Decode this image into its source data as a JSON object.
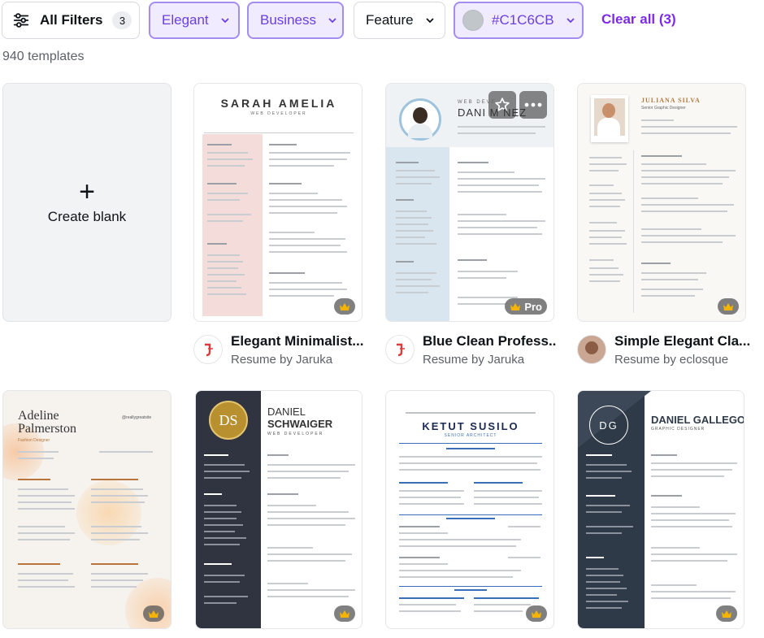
{
  "filters": {
    "all_filters_label": "All Filters",
    "all_filters_count": "3",
    "chips": [
      {
        "label": "Elegant",
        "selected": true
      },
      {
        "label": "Business",
        "selected": true
      },
      {
        "label": "Feature",
        "selected": false
      },
      {
        "label": "#C1C6CB",
        "selected": true,
        "swatch": "#C1C6CB"
      }
    ],
    "clear_all_label": "Clear all (3)"
  },
  "results": {
    "count_text": "940 templates"
  },
  "create_blank": {
    "label": "Create blank",
    "icon": "plus-icon"
  },
  "row1": [
    {
      "title": "Elegant Minimalist...",
      "subtitle": "Resume by Jaruka",
      "badge": "crown",
      "preview": {
        "name": "SARAH AMELIA",
        "role": "WEB DEVELOPER"
      }
    },
    {
      "title": "Blue Clean Profess...",
      "subtitle": "Resume by Jaruka",
      "badge": "Pro",
      "preview": {
        "role": "WEB DEVE",
        "name": "DANI M    NEZ"
      }
    },
    {
      "title": "Simple Elegant Cla...",
      "subtitle": "Resume by eclosque",
      "badge": "crown",
      "preview": {
        "name": "JULIANA SILVA",
        "role": "Senior Graphic Designer"
      }
    }
  ],
  "row2": [
    {
      "preview": {
        "name_line1": "Adeline",
        "name_line2": "Palmerston",
        "role": "Fashion Designer",
        "handle": "@reallygreatsite"
      }
    },
    {
      "preview": {
        "initials": "DS",
        "name_line1": "DANIEL",
        "name_line2": "SCHWAIGER",
        "role": "WEB DEVELOPER"
      }
    },
    {
      "preview": {
        "name": "KETUT SUSILO",
        "role": "SENIOR ARCHITECT"
      }
    },
    {
      "preview": {
        "initials": "DG",
        "name": "DANIEL GALLEGO",
        "role": "GRAPHIC DESIGNER"
      }
    }
  ],
  "colors": {
    "accent": "#7d2ae8",
    "selected_bg": "#f0ebfe",
    "selected_border": "#a58cf0"
  }
}
